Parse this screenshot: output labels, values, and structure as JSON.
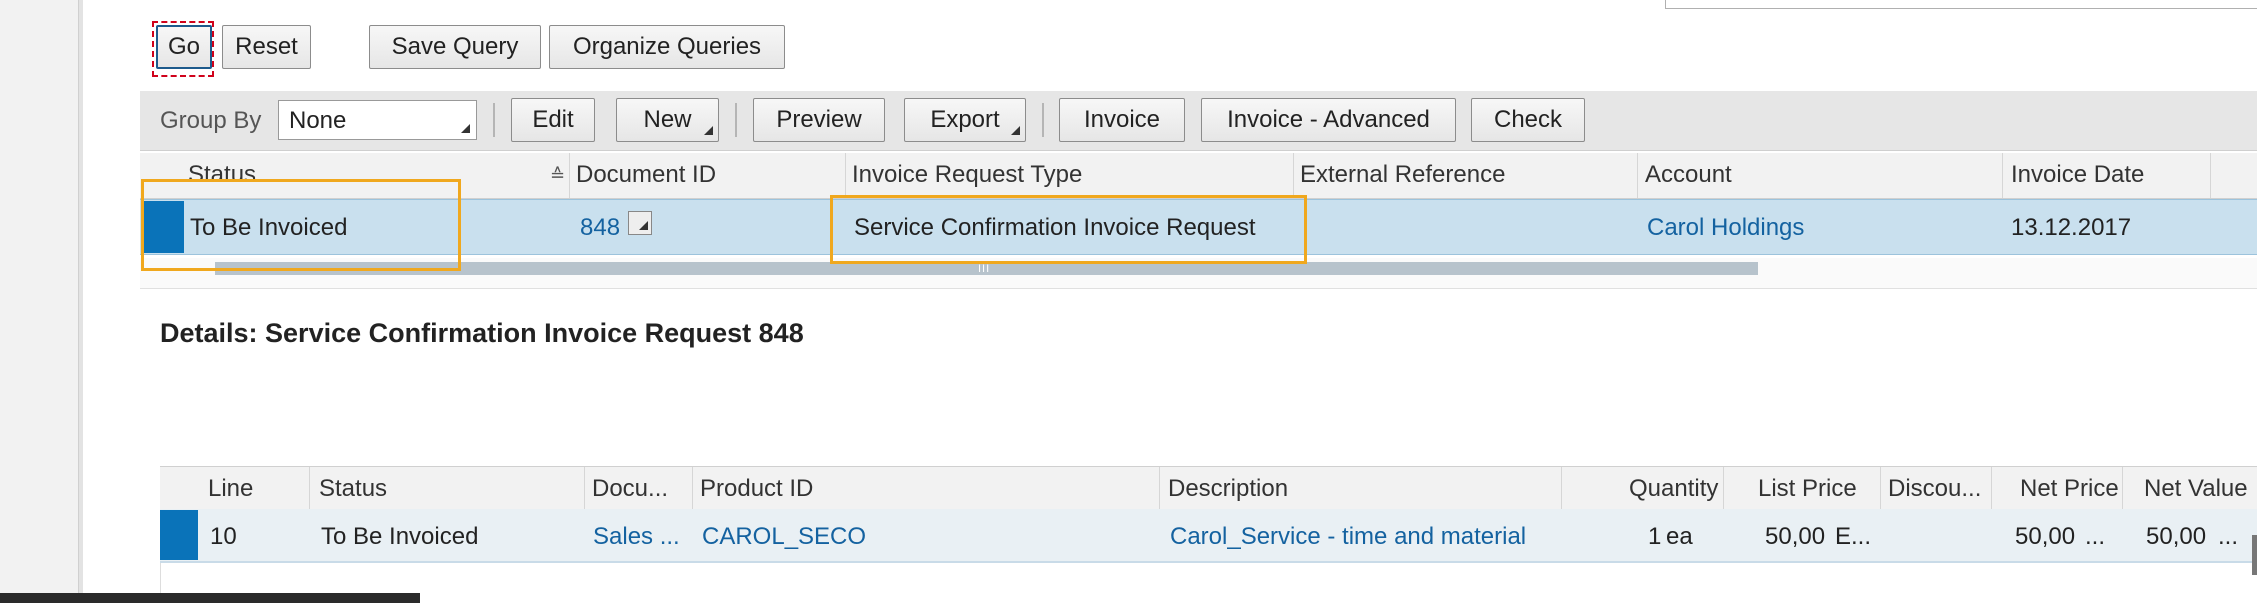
{
  "query_buttons": {
    "go": "Go",
    "reset": "Reset",
    "save_query": "Save Query",
    "organize_queries": "Organize Queries"
  },
  "toolbar": {
    "group_by_label": "Group By",
    "group_by_value": "None",
    "edit": "Edit",
    "new": "New",
    "preview": "Preview",
    "export": "Export",
    "invoice": "Invoice",
    "invoice_advanced": "Invoice - Advanced",
    "check": "Check"
  },
  "main_table": {
    "columns": [
      "Status",
      "Document ID",
      "Invoice Request Type",
      "External Reference",
      "Account",
      "Invoice Date"
    ],
    "rows": [
      {
        "status": "To Be Invoiced",
        "document_id": "848",
        "invoice_request_type": "Service Confirmation Invoice Request",
        "external_reference": "",
        "account": "Carol Holdings",
        "invoice_date": "13.12.2017"
      }
    ]
  },
  "details": {
    "title": "Details: Service Confirmation Invoice Request 848",
    "columns": [
      "Line",
      "Status",
      "Docu...",
      "Product ID",
      "Description",
      "Quantity",
      "List Price",
      "Discou...",
      "Net Price",
      "Net Value"
    ],
    "rows": [
      {
        "line": "10",
        "status": "To Be Invoiced",
        "document": "Sales ...",
        "product_id": "CAROL_SECO",
        "description": "Carol_Service - time and material",
        "quantity": "1",
        "unit": "ea",
        "list_price": "50,00",
        "list_price_currency": "E...",
        "discount": "",
        "net_price": "50,00",
        "net_price_currency": "...",
        "net_value": "50,00",
        "net_value_currency": "..."
      }
    ]
  },
  "colors": {
    "accent": "#0a73b9",
    "link": "#1462a0",
    "selected_row": "#c9e0ee",
    "highlight_box": "#f0a81e",
    "focus_outline": "#d0021b"
  }
}
